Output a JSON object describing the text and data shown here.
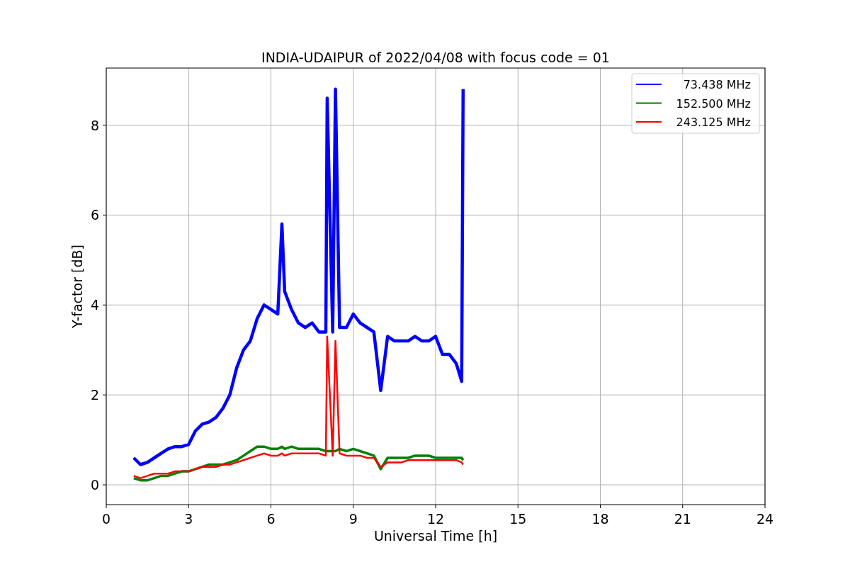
{
  "chart_data": {
    "type": "line",
    "title": "INDIA-UDAIPUR of 2022/04/08 with focus code = 01",
    "xlabel": "Universal Time [h]",
    "ylabel": "Y-factor [dB]",
    "x": [
      1,
      1.25,
      1.5,
      1.75,
      2,
      2.25,
      2.5,
      2.75,
      3,
      3.25,
      3.5,
      3.75,
      4,
      4.25,
      4.5,
      4.75,
      5,
      5.25,
      5.5,
      5.75,
      6,
      6.25,
      6.4,
      6.5,
      6.75,
      7,
      7.25,
      7.5,
      7.75,
      8,
      8.05,
      8.25,
      8.35,
      8.5,
      8.75,
      9,
      9.25,
      9.5,
      9.75,
      10,
      10.25,
      10.5,
      10.75,
      11,
      11.25,
      11.5,
      11.75,
      12,
      12.25,
      12.5,
      12.75,
      12.95,
      13
    ],
    "series": [
      {
        "name": "73.438 MHz",
        "color": "#0000ff",
        "values": [
          0.6,
          0.45,
          0.5,
          0.6,
          0.7,
          0.8,
          0.85,
          0.85,
          0.9,
          1.2,
          1.35,
          1.4,
          1.5,
          1.7,
          2.0,
          2.6,
          3.0,
          3.2,
          3.7,
          4.0,
          3.9,
          3.8,
          5.8,
          4.3,
          3.9,
          3.6,
          3.5,
          3.6,
          3.4,
          3.4,
          8.6,
          3.4,
          8.8,
          3.5,
          3.5,
          3.8,
          3.6,
          3.5,
          3.4,
          2.1,
          3.3,
          3.2,
          3.2,
          3.2,
          3.3,
          3.2,
          3.2,
          3.3,
          2.9,
          2.9,
          2.7,
          2.3,
          8.8
        ]
      },
      {
        "name": "152.500 MHz",
        "color": "#008000",
        "values": [
          0.15,
          0.1,
          0.1,
          0.15,
          0.2,
          0.2,
          0.25,
          0.3,
          0.3,
          0.35,
          0.4,
          0.45,
          0.45,
          0.45,
          0.5,
          0.55,
          0.65,
          0.75,
          0.85,
          0.85,
          0.8,
          0.8,
          0.85,
          0.8,
          0.85,
          0.8,
          0.8,
          0.8,
          0.8,
          0.75,
          0.75,
          0.75,
          0.75,
          0.8,
          0.75,
          0.8,
          0.75,
          0.7,
          0.65,
          0.35,
          0.6,
          0.6,
          0.6,
          0.6,
          0.65,
          0.65,
          0.65,
          0.6,
          0.6,
          0.6,
          0.6,
          0.6,
          0.55
        ]
      },
      {
        "name": "243.125 MHz",
        "color": "#ff0000",
        "values": [
          0.2,
          0.15,
          0.2,
          0.25,
          0.25,
          0.25,
          0.3,
          0.3,
          0.3,
          0.35,
          0.4,
          0.4,
          0.4,
          0.45,
          0.45,
          0.5,
          0.55,
          0.6,
          0.65,
          0.7,
          0.65,
          0.65,
          0.7,
          0.65,
          0.7,
          0.7,
          0.7,
          0.7,
          0.7,
          0.65,
          3.3,
          0.65,
          3.2,
          0.7,
          0.65,
          0.65,
          0.65,
          0.6,
          0.6,
          0.4,
          0.5,
          0.5,
          0.5,
          0.55,
          0.55,
          0.55,
          0.55,
          0.55,
          0.55,
          0.55,
          0.55,
          0.5,
          0.45
        ]
      }
    ],
    "xlim": [
      0,
      24
    ],
    "ylim": [
      -0.44,
      9.27
    ],
    "xticks": [
      0,
      3,
      6,
      9,
      12,
      15,
      18,
      21,
      24
    ],
    "yticks": [
      0,
      2,
      4,
      6,
      8
    ],
    "grid": true,
    "legend": "upper right"
  }
}
